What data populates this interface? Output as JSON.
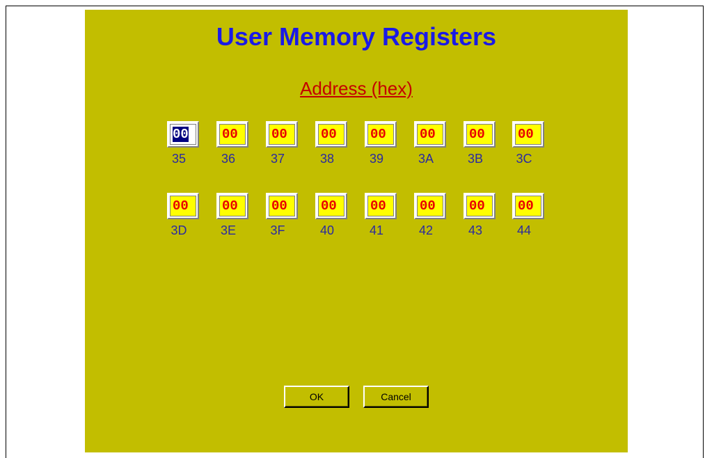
{
  "dialog": {
    "title": "User Memory Registers",
    "subtitle": "Address (hex)"
  },
  "registers": [
    {
      "address": "35",
      "value": "00"
    },
    {
      "address": "36",
      "value": "00"
    },
    {
      "address": "37",
      "value": "00"
    },
    {
      "address": "38",
      "value": "00"
    },
    {
      "address": "39",
      "value": "00"
    },
    {
      "address": "3A",
      "value": "00"
    },
    {
      "address": "3B",
      "value": "00"
    },
    {
      "address": "3C",
      "value": "00"
    },
    {
      "address": "3D",
      "value": "00"
    },
    {
      "address": "3E",
      "value": "00"
    },
    {
      "address": "3F",
      "value": "00"
    },
    {
      "address": "40",
      "value": "00"
    },
    {
      "address": "41",
      "value": "00"
    },
    {
      "address": "42",
      "value": "00"
    },
    {
      "address": "43",
      "value": "00"
    },
    {
      "address": "44",
      "value": "00"
    }
  ],
  "buttons": {
    "ok_label": "OK",
    "cancel_label": "Cancel"
  },
  "colors": {
    "dialog_background": "#c2be00",
    "title": "#1a1ae6",
    "subtitle": "#c40000",
    "register_value": "#e80000",
    "register_field": "#ffff00",
    "address_label": "#2a2aa0"
  }
}
